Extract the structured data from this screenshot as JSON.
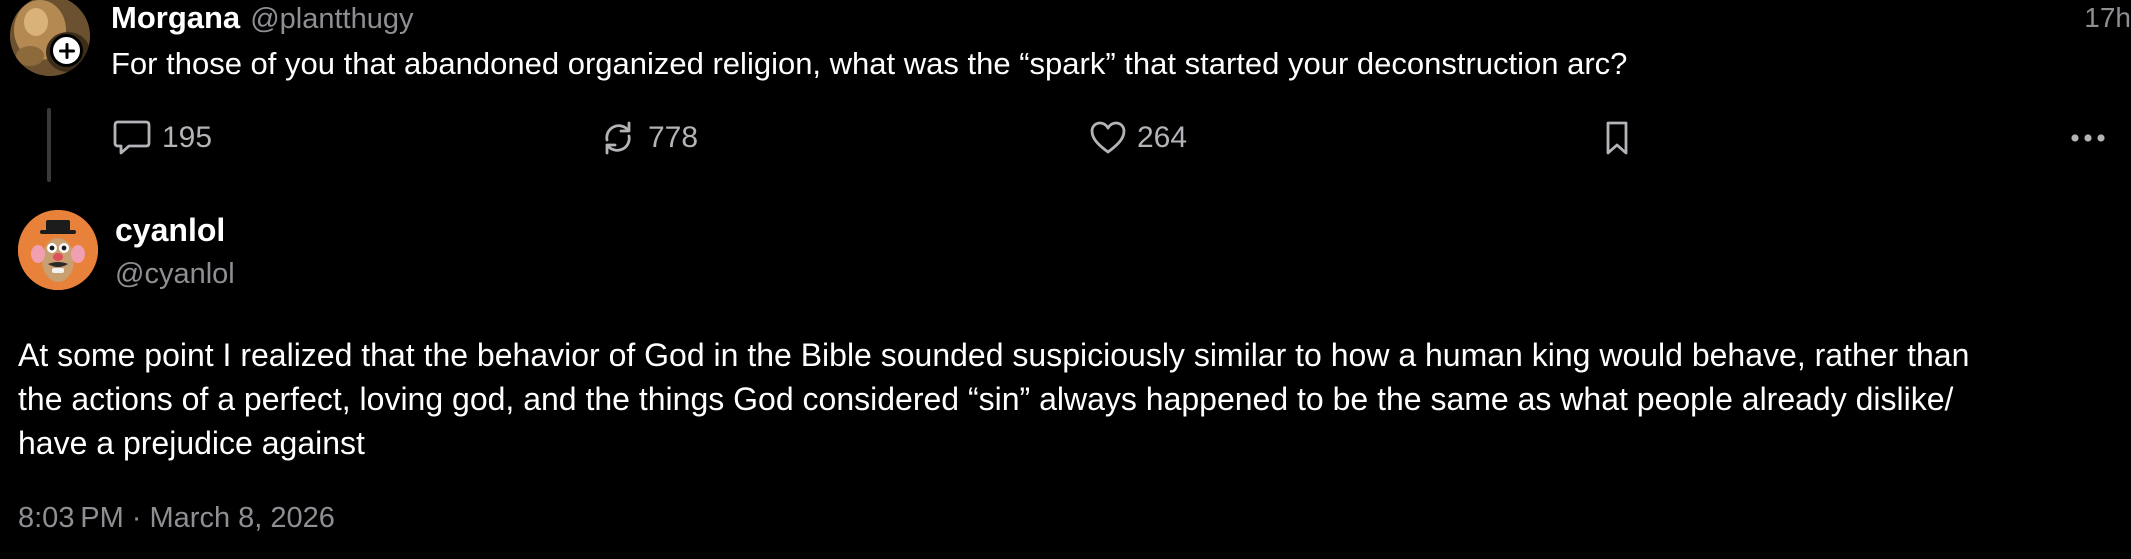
{
  "parent_post": {
    "author_name": "Morgana",
    "author_handle": "@plantthugy",
    "time_ago": "17h",
    "text": "For those of you that abandoned organized religion, what was the “spark” that started your deconstruction arc?",
    "avatar_icon": "profile-photo-icon",
    "follow_badge_icon": "plus-icon",
    "actions": {
      "reply": {
        "icon": "speech-bubble-icon",
        "count": "195"
      },
      "repost": {
        "icon": "repost-arrows-icon",
        "count": "778"
      },
      "like": {
        "icon": "heart-icon",
        "count": "264"
      },
      "bookmark": {
        "icon": "bookmark-icon"
      },
      "more": {
        "icon": "ellipsis-icon"
      }
    }
  },
  "reply_post": {
    "author_name": "cyanlol",
    "author_handle": "@cyanlol",
    "avatar_icon": "potato-toy-avatar-icon",
    "text_lines": [
      "At some point I realized that the behavior of God in the Bible sounded suspiciously similar to how a human king would behave, rather than",
      "the actions of a perfect, loving god, and the things God considered “sin” always happened to be the same as what people already dislike/",
      "have a prejudice against"
    ],
    "timestamp": "8:03 PM · March 8, 2026"
  },
  "colors": {
    "background": "#000000",
    "primary_text": "#ffffff",
    "secondary_text": "#8e8e93",
    "icon_gray": "#b3b3b8",
    "thread_line": "#3a3a3a"
  }
}
